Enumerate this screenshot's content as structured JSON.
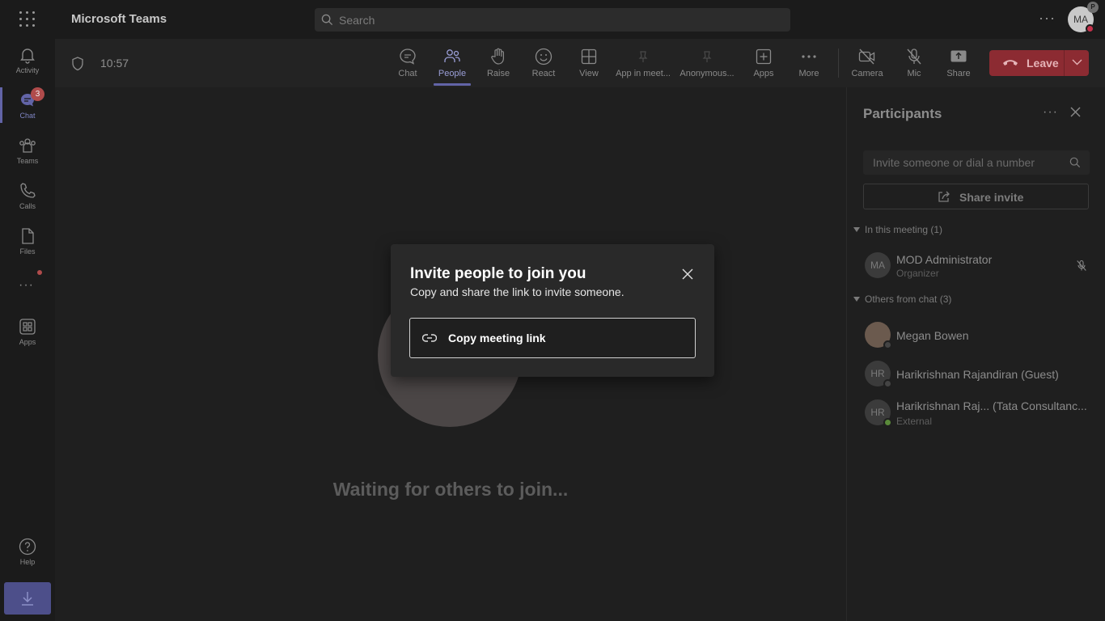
{
  "app": {
    "title": "Microsoft Teams"
  },
  "search": {
    "placeholder": "Search"
  },
  "user": {
    "initials": "MA",
    "badge": "P"
  },
  "rail": {
    "items": [
      {
        "label": "Activity",
        "icon": "bell-icon"
      },
      {
        "label": "Chat",
        "icon": "chat-icon",
        "badge": "3",
        "active": true
      },
      {
        "label": "Teams",
        "icon": "teams-icon"
      },
      {
        "label": "Calls",
        "icon": "phone-icon"
      },
      {
        "label": "Files",
        "icon": "file-icon"
      },
      {
        "label": "Apps",
        "icon": "apps-icon"
      },
      {
        "label": "Help",
        "icon": "help-icon"
      }
    ]
  },
  "meeting": {
    "timer": "10:57",
    "toolbar": {
      "chat": "Chat",
      "people": "People",
      "raise": "Raise",
      "react": "React",
      "view": "View",
      "app_in_meeting": "App in meet...",
      "anonymous": "Anonymous...",
      "apps": "Apps",
      "more": "More",
      "camera": "Camera",
      "mic": "Mic",
      "share": "Share",
      "leave": "Leave"
    },
    "waiting_text": "Waiting for others to join..."
  },
  "participants": {
    "title": "Participants",
    "invite_placeholder": "Invite someone or dial a number",
    "share_invite": "Share invite",
    "in_meeting_header": "In this meeting (1)",
    "in_meeting": [
      {
        "initials": "MA",
        "name": "MOD Administrator",
        "role": "Organizer"
      }
    ],
    "others_header": "Others from chat (3)",
    "others": [
      {
        "initials": "",
        "name": "Megan Bowen",
        "role": ""
      },
      {
        "initials": "HR",
        "name": "Harikrishnan Rajandiran (Guest)",
        "role": ""
      },
      {
        "initials": "HR",
        "name": "Harikrishnan Raj...  (Tata Consultanc...",
        "role": "External"
      }
    ]
  },
  "dialog": {
    "title": "Invite people to join you",
    "subtitle": "Copy and share the link to invite someone.",
    "copy_link": "Copy meeting link"
  },
  "colors": {
    "accent": "#6264a7",
    "leave": "#8c2b32",
    "badge": "#b04b4b"
  }
}
